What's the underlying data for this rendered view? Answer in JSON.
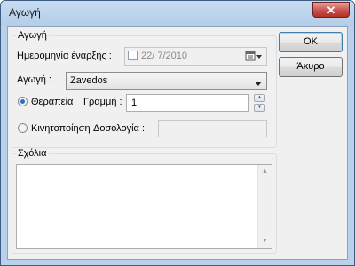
{
  "window": {
    "title": "Αγωγή",
    "close_glyph": "✕"
  },
  "group_main": {
    "label": "Αγωγή",
    "start_date_label": "Ημερομηνία έναρξης :",
    "start_date_value": "22/  7/2010",
    "treatment_label": "Αγωγή :",
    "treatment_value": "Zavedos",
    "radio_therapy_label": "Θεραπεία",
    "line_label": "Γραμμή :",
    "line_value": "1",
    "radio_mobilization_label": "Κινητοποίηση",
    "dosage_label": "Δοσολογία :",
    "dosage_value": "",
    "selected_radio": "therapy"
  },
  "group_comments": {
    "label": "Σχόλια",
    "value": ""
  },
  "buttons": {
    "ok": "OK",
    "cancel": "Άκυρο"
  }
}
